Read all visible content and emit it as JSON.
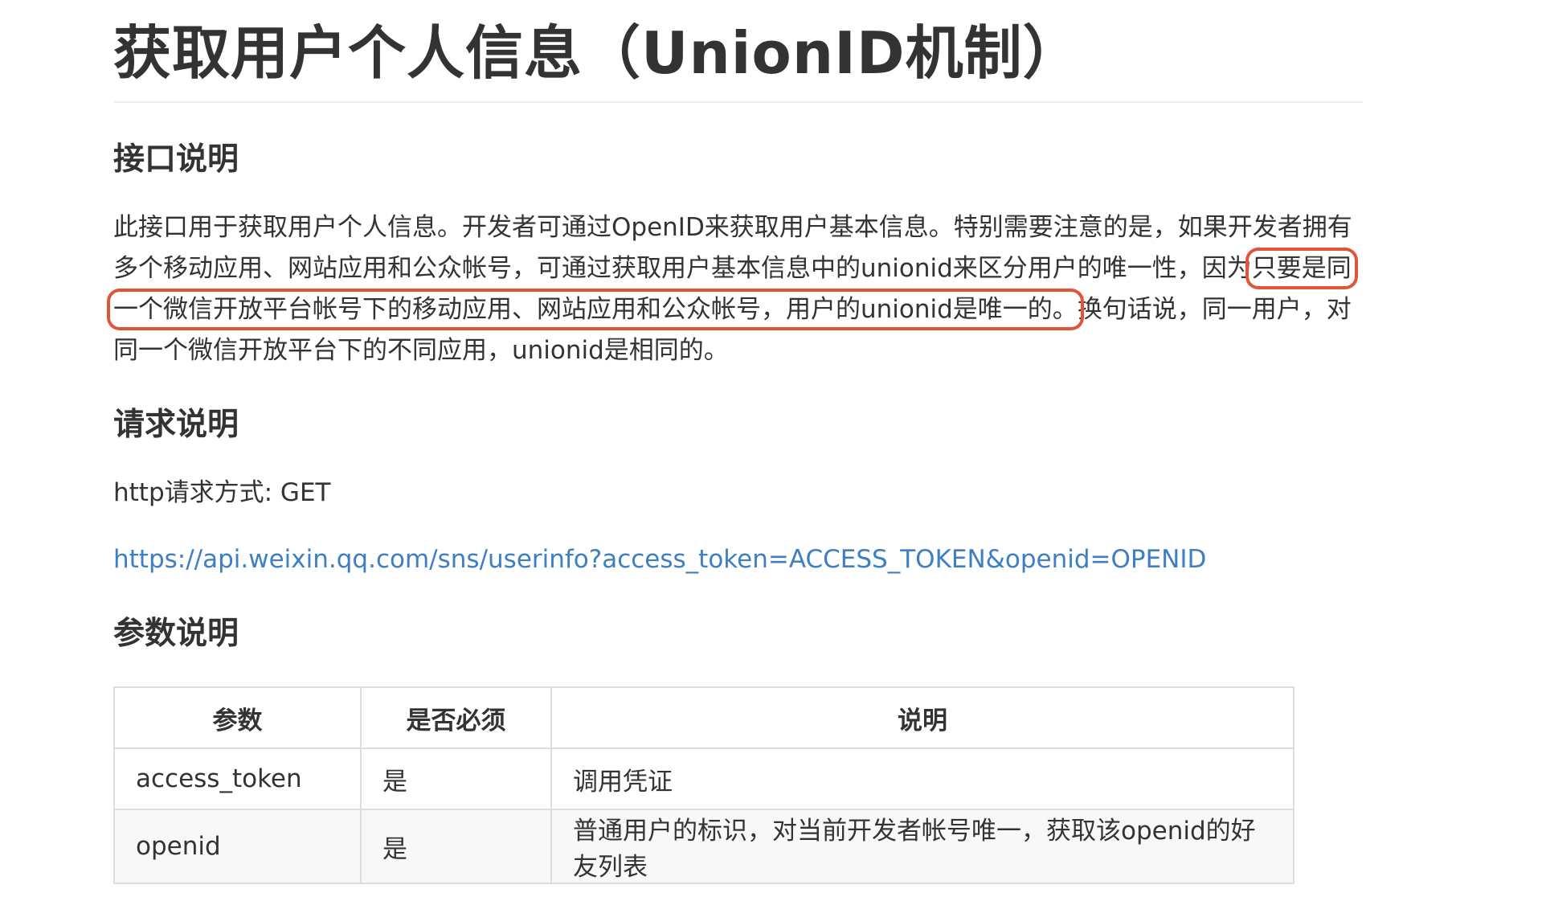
{
  "page": {
    "title": "获取用户个人信息（UnionID机制）"
  },
  "sections": {
    "interface": {
      "heading": "接口说明",
      "para_before": "此接口用于获取用户个人信息。开发者可通过OpenID来获取用户基本信息。特别需要注意的是，如果开发者拥有多个移动应用、网站应用和公众帐号，可通过获取用户基本信息中的unionid来区分用户的唯一性，因为",
      "para_highlight": "只要是同一个微信开放平台帐号下的移动应用、网站应用和公众帐号，用户的unionid是唯一的。",
      "para_after": "换句话说，同一用户，对同一个微信开放平台下的不同应用，unionid是相同的。"
    },
    "request": {
      "heading": "请求说明",
      "method_line": "http请求方式: GET",
      "url": "https://api.weixin.qq.com/sns/userinfo?access_token=ACCESS_TOKEN&openid=OPENID"
    },
    "params": {
      "heading": "参数说明",
      "table": {
        "headers": [
          "参数",
          "是否必须",
          "说明"
        ],
        "rows": [
          [
            "access_token",
            "是",
            "调用凭证"
          ],
          [
            "openid",
            "是",
            "普通用户的标识，对当前开发者帐号唯一，获取该openid的好友列表"
          ]
        ]
      }
    }
  },
  "colors": {
    "highlight_border": "#e1543a",
    "link": "#3d7fc2",
    "text": "#333333"
  }
}
